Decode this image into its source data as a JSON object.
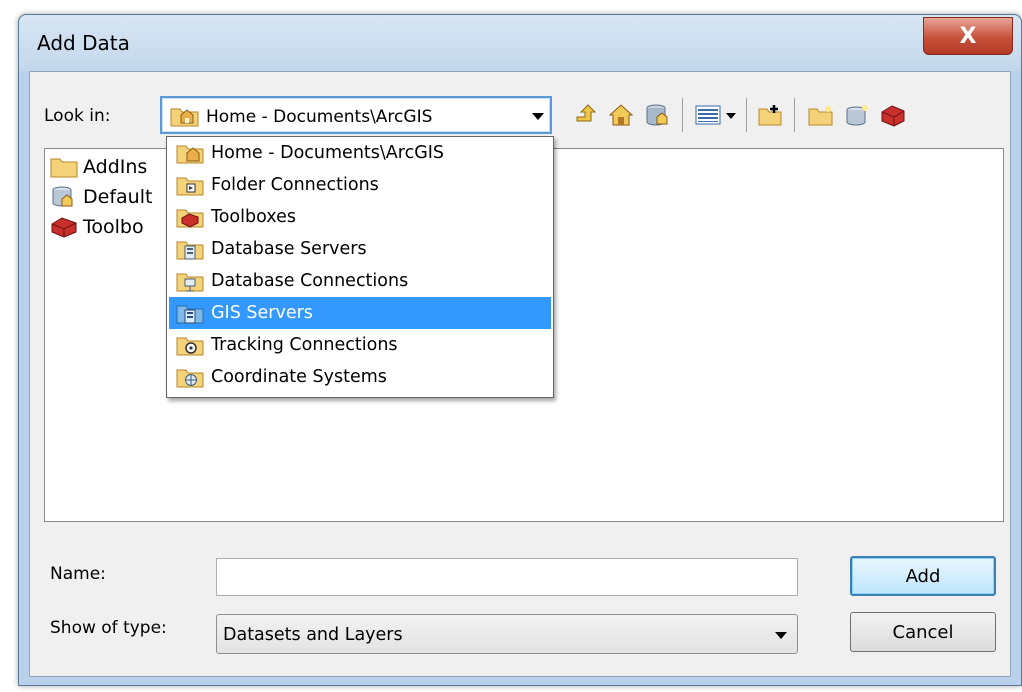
{
  "window": {
    "title": "Add Data",
    "close_glyph": "X"
  },
  "look_in": {
    "label": "Look in:",
    "value": "Home - Documents\\ArcGIS",
    "icon": "home-folder-icon"
  },
  "toolbar": {
    "buttons": [
      {
        "name": "up-one-level-icon"
      },
      {
        "name": "home-icon"
      },
      {
        "name": "default-geodatabase-icon"
      },
      {
        "name": "view-list-icon"
      },
      {
        "name": "connect-to-folder-icon"
      },
      {
        "name": "new-folder-icon"
      },
      {
        "name": "new-geodatabase-icon"
      },
      {
        "name": "toolbox-icon"
      }
    ]
  },
  "files": [
    {
      "label": "AddIns",
      "icon": "folder-icon"
    },
    {
      "label": "Default",
      "icon": "geodatabase-icon"
    },
    {
      "label": "Toolbo",
      "icon": "toolbox-icon"
    }
  ],
  "dropdown": {
    "items": [
      {
        "label": "Home - Documents\\ArcGIS",
        "icon": "home-folder-icon",
        "selected": false
      },
      {
        "label": "Folder Connections",
        "icon": "folder-connection-icon",
        "selected": false
      },
      {
        "label": "Toolboxes",
        "icon": "toolbox-icon",
        "selected": false
      },
      {
        "label": "Database Servers",
        "icon": "database-server-icon",
        "selected": false
      },
      {
        "label": "Database Connections",
        "icon": "database-connection-icon",
        "selected": false
      },
      {
        "label": "GIS Servers",
        "icon": "gis-server-icon",
        "selected": true
      },
      {
        "label": "Tracking Connections",
        "icon": "tracking-connection-icon",
        "selected": false
      },
      {
        "label": "Coordinate Systems",
        "icon": "coordinate-system-icon",
        "selected": false
      }
    ]
  },
  "name_field": {
    "label": "Name:",
    "value": ""
  },
  "type_field": {
    "label": "Show of type:",
    "value": "Datasets and Layers"
  },
  "buttons": {
    "add": "Add",
    "cancel": "Cancel"
  },
  "colors": {
    "selection": "#3399ff",
    "dialog_frame": "#b9d1ea",
    "close": "#c7503a"
  }
}
